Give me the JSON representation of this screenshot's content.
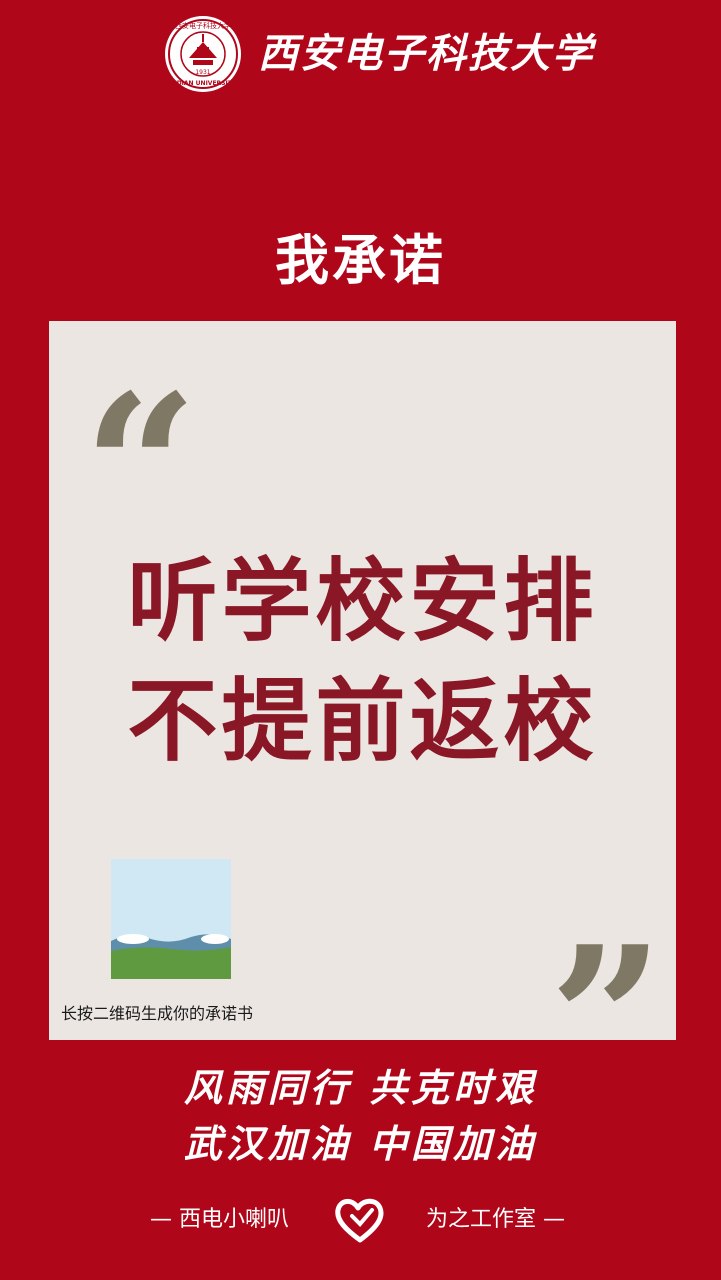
{
  "colors": {
    "background": "#b0061a",
    "card": "#ebe6e1",
    "pledge_text": "#8a1726",
    "quote_marks": "#7e7864",
    "white": "#ffffff"
  },
  "header": {
    "logo_icon": "university-seal-icon",
    "seal_motto": "西安电子科技大学",
    "seal_english": "XIDIAN UNIVERSITY",
    "seal_year": "1931",
    "university_name": "西安电子科技大学"
  },
  "pledge": {
    "title": "我承诺",
    "open_quote": "“",
    "close_quote": "”",
    "line_1": "听学校安排",
    "line_2": "不提前返校",
    "qr_caption": "长按二维码生成你的承诺书"
  },
  "slogans": {
    "line_1": "风雨同行 共克时艰",
    "line_2": "武汉加油 中国加油"
  },
  "footer": {
    "left_text": "— 西电小喇叭",
    "right_text": "为之工作室 —",
    "heart_icon": "heart-icon"
  }
}
